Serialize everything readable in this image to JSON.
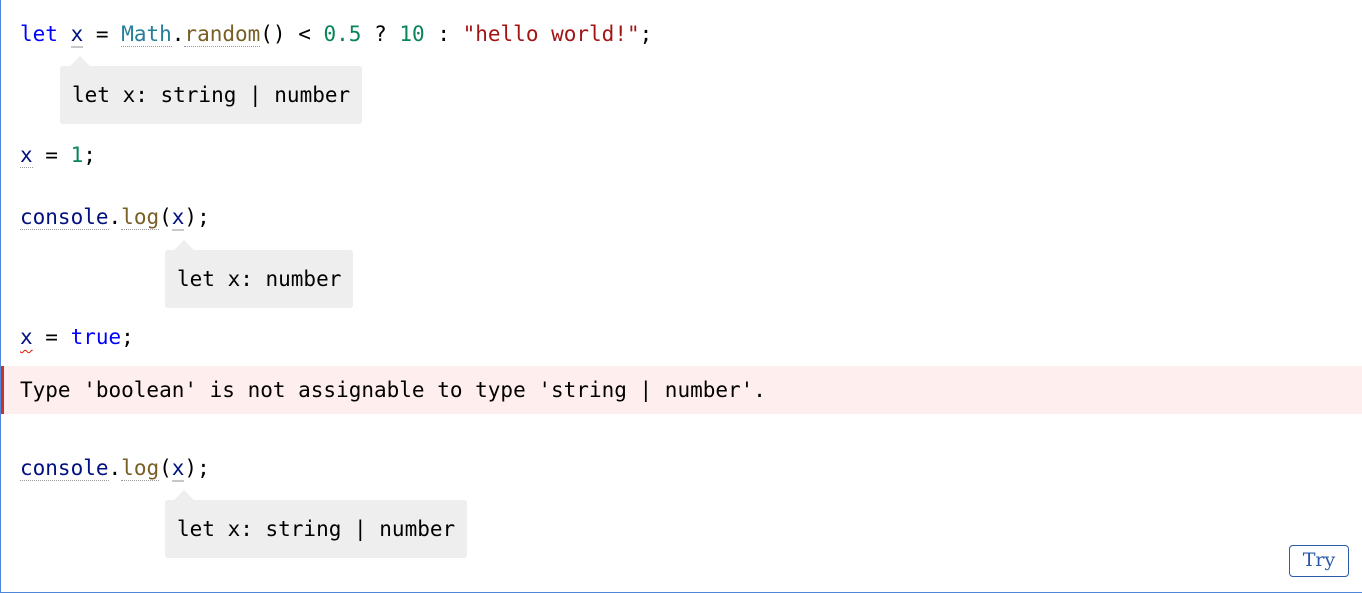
{
  "colors": {
    "keyword": "#0000ff",
    "variable": "#001080",
    "type_ident": "#267f99",
    "function": "#795e26",
    "number": "#098658",
    "string": "#a31515",
    "error_bg": "#ffeeee",
    "error_border": "#c8322b",
    "popover_bg": "#eeeeee",
    "accent": "#2b5aa8"
  },
  "code": {
    "line1": {
      "kw_let": "let",
      "var_x": "x",
      "op_eq": " = ",
      "math": "Math",
      "dot": ".",
      "random": "random",
      "call_lt": "() < ",
      "num_half": "0.5",
      "op_q": " ? ",
      "num_ten": "10",
      "op_colon": " : ",
      "str_hello": "\"hello world!\"",
      "semi": ";"
    },
    "line2": {
      "var_x": "x",
      "op_eq": " = ",
      "num_one": "1",
      "semi": ";"
    },
    "line3": {
      "console": "console",
      "dot": ".",
      "log": "log",
      "paren_open": "(",
      "var_x": "x",
      "paren_close": ");"
    },
    "line4": {
      "var_x": "x",
      "op_eq": " = ",
      "kw_true": "true",
      "semi": ";"
    },
    "line5": {
      "console": "console",
      "dot": ".",
      "log": "log",
      "paren_open": "(",
      "var_x": "x",
      "paren_close": ");"
    }
  },
  "popovers": {
    "first": "let x: string | number",
    "second": "let x: number",
    "third": "let x: string | number"
  },
  "error": {
    "message": "Type 'boolean' is not assignable to type 'string | number'."
  },
  "toolbar": {
    "try_label": "Try"
  }
}
